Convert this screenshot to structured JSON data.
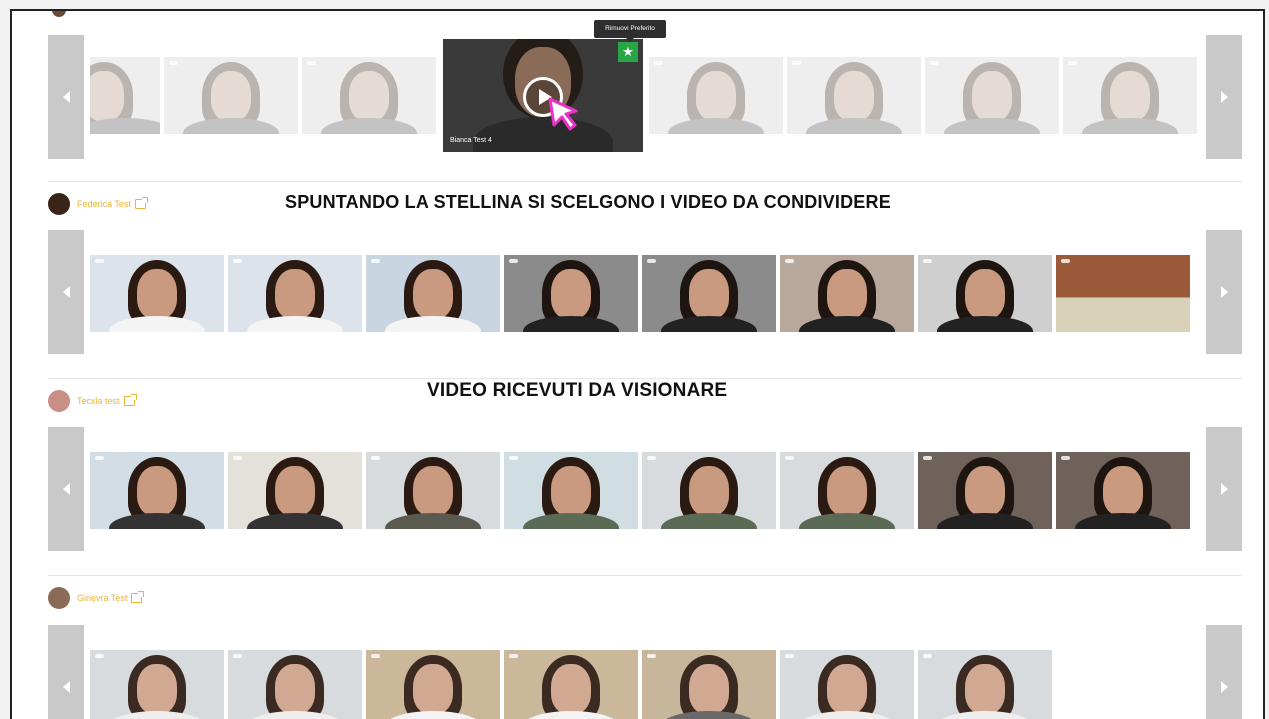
{
  "featured": {
    "caption": "Bianca Test 4",
    "tooltip": "Rimuovi Preferito",
    "star_icon": "★"
  },
  "overlays": {
    "first": "SPUNTANDO LA STELLINA SI SCELGONO I VIDEO DA CONDIVIDERE",
    "second": "VIDEO RICEVUTI DA VISIONARE"
  },
  "users": [
    {
      "name": "Federica Test"
    },
    {
      "name": "Tecxla test"
    },
    {
      "name": "Ginevra Test"
    }
  ],
  "colors": {
    "accent": "#e9b43a",
    "favorite": "#27a745",
    "cursor": "#e832c8"
  }
}
